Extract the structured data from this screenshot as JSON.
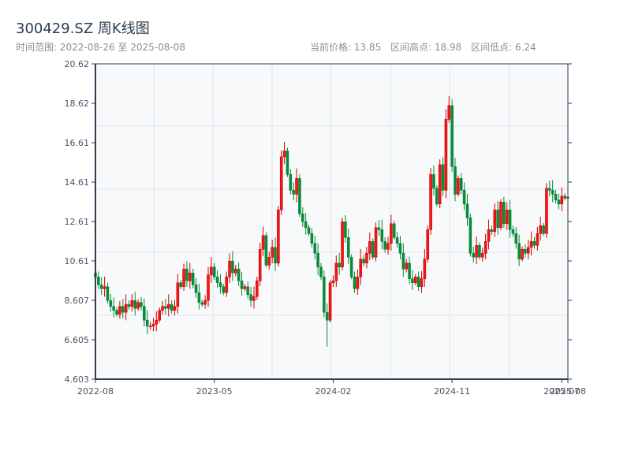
{
  "header": {
    "title": "300429.SZ 周K线图",
    "range_label": "时间范围: 2022-08-26 至 2025-08-08",
    "current_price": "当前价格: 13.85",
    "range_high": "区间高点: 18.98",
    "range_low": "区间低点: 6.24"
  },
  "colors": {
    "up": "#d40000",
    "up_fill": "#f01818",
    "down": "#0a8a3a",
    "axis": "#2c3e50",
    "grid": "#e1e5ea",
    "plot_bg": "#f7f9fb"
  },
  "chart_data": {
    "type": "candlestick",
    "title": "300429.SZ 周K线图",
    "ylim": [
      4.603,
      20.62
    ],
    "y_ticks": [
      "4.603",
      "6.605",
      "8.607",
      "10.61",
      "12.61",
      "14.61",
      "16.61",
      "18.62",
      "20.62"
    ],
    "x_ticks": [
      "2022-08",
      "2023-05",
      "2024-02",
      "2024-11",
      "2025-07",
      "2025-08"
    ],
    "x_tick_weeks": [
      0,
      39,
      78,
      117,
      154,
      155
    ],
    "first_open": 10.0,
    "high_max": 18.98,
    "low_min": 6.24,
    "closes": [
      9.8,
      9.4,
      9.2,
      9.3,
      8.6,
      8.3,
      8.1,
      7.9,
      8.3,
      8.0,
      8.4,
      8.3,
      8.6,
      8.2,
      8.5,
      8.3,
      7.6,
      7.3,
      7.3,
      7.4,
      7.6,
      8.1,
      8.3,
      8.2,
      8.4,
      8.1,
      8.3,
      9.5,
      9.3,
      10.2,
      9.6,
      10.0,
      9.4,
      9.0,
      8.5,
      8.4,
      8.6,
      9.9,
      10.3,
      9.8,
      9.5,
      9.3,
      9.0,
      9.8,
      10.6,
      10.0,
      10.2,
      9.6,
      9.2,
      9.3,
      8.9,
      8.6,
      8.8,
      9.6,
      11.2,
      11.9,
      10.4,
      10.8,
      11.3,
      10.5,
      13.2,
      15.9,
      16.2,
      15.0,
      14.2,
      14.0,
      14.8,
      13.0,
      12.6,
      12.3,
      12.0,
      11.5,
      11.0,
      10.3,
      9.8,
      8.0,
      7.6,
      9.5,
      9.6,
      10.5,
      10.3,
      12.6,
      11.8,
      10.8,
      9.8,
      9.2,
      9.8,
      10.7,
      10.5,
      11.0,
      11.6,
      10.8,
      12.3,
      12.2,
      11.6,
      11.2,
      11.5,
      12.5,
      11.8,
      11.5,
      11.0,
      10.2,
      10.5,
      9.7,
      9.5,
      9.8,
      9.3,
      9.7,
      10.7,
      12.2,
      15.0,
      14.3,
      13.5,
      15.5,
      14.2,
      17.8,
      18.5,
      15.4,
      14.0,
      14.8,
      14.2,
      13.5,
      12.8,
      11.0,
      10.8,
      11.4,
      10.8,
      11.0,
      11.6,
      12.2,
      12.1,
      13.2,
      12.3,
      13.6,
      12.5,
      13.2,
      12.2,
      12.0,
      11.5,
      10.7,
      11.2,
      11.0,
      11.3,
      11.6,
      11.4,
      12.0,
      12.4,
      12.0,
      14.3,
      14.2,
      14.0,
      13.7,
      13.5,
      13.9,
      13.8,
      13.85
    ]
  }
}
